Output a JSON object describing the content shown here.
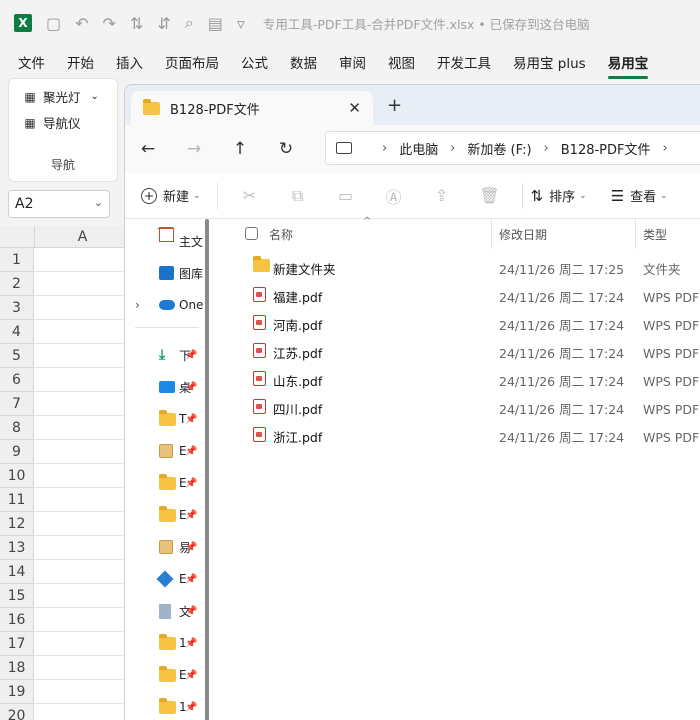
{
  "excel": {
    "filename": "专用工具-PDF工具-合并PDF文件.xlsx • 已保存到这台电脑",
    "tabs": [
      "文件",
      "开始",
      "插入",
      "页面布局",
      "公式",
      "数据",
      "审阅",
      "视图",
      "开发工具",
      "易用宝 plus",
      "易用宝"
    ],
    "active_tab_index": 10,
    "ribbon": {
      "spotlight": "聚光灯",
      "navigator": "导航仪",
      "group_label": "导航"
    },
    "name_box": "A2",
    "column": "A",
    "rows": [
      "1",
      "2",
      "3",
      "4",
      "5",
      "6",
      "7",
      "8",
      "9",
      "10",
      "11",
      "12",
      "13",
      "14",
      "15",
      "16",
      "17",
      "18",
      "19",
      "20"
    ]
  },
  "explorer": {
    "tab_title": "B128-PDF文件",
    "breadcrumb": [
      "此电脑",
      "新加卷 (F:)",
      "B128-PDF文件"
    ],
    "commands": {
      "new": "新建",
      "sort": "排序",
      "view": "查看"
    },
    "nav_pane": [
      {
        "label": "主文",
        "icon": "home-icon",
        "chevron": false
      },
      {
        "label": "图库",
        "icon": "gallery-icon",
        "chevron": false
      },
      {
        "label": "One",
        "icon": "onedrive-icon",
        "chevron": true
      },
      {
        "label": "下",
        "icon": "download-icon",
        "pinned": true
      },
      {
        "label": "桌",
        "icon": "desktop-icon",
        "pinned": true
      },
      {
        "label": "T",
        "icon": "folder-icon",
        "pinned": true
      },
      {
        "label": "E",
        "icon": "package-icon",
        "pinned": true
      },
      {
        "label": "E",
        "icon": "folder-icon",
        "pinned": true
      },
      {
        "label": "E",
        "icon": "folder-icon",
        "pinned": true
      },
      {
        "label": "易",
        "icon": "package-icon",
        "pinned": true
      },
      {
        "label": "E",
        "icon": "diamond-icon",
        "pinned": true
      },
      {
        "label": "文",
        "icon": "document-icon",
        "pinned": true
      },
      {
        "label": "1",
        "icon": "folder-icon",
        "pinned": true
      },
      {
        "label": "E",
        "icon": "folder-icon",
        "pinned": true
      },
      {
        "label": "1",
        "icon": "folder-icon",
        "pinned": true
      }
    ],
    "columns": {
      "name": "名称",
      "date": "修改日期",
      "type": "类型"
    },
    "files": [
      {
        "name": "新建文件夹",
        "date": "24/11/26 周二 17:25",
        "type": "文件夹",
        "icon": "folder-icon"
      },
      {
        "name": "福建.pdf",
        "date": "24/11/26 周二 17:24",
        "type": "WPS PDF 文",
        "icon": "pdf-icon"
      },
      {
        "name": "河南.pdf",
        "date": "24/11/26 周二 17:24",
        "type": "WPS PDF 文",
        "icon": "pdf-icon"
      },
      {
        "name": "江苏.pdf",
        "date": "24/11/26 周二 17:24",
        "type": "WPS PDF 文",
        "icon": "pdf-icon"
      },
      {
        "name": "山东.pdf",
        "date": "24/11/26 周二 17:24",
        "type": "WPS PDF 文",
        "icon": "pdf-icon"
      },
      {
        "name": "四川.pdf",
        "date": "24/11/26 周二 17:24",
        "type": "WPS PDF 文",
        "icon": "pdf-icon"
      },
      {
        "name": "浙江.pdf",
        "date": "24/11/26 周二 17:24",
        "type": "WPS PDF 文",
        "icon": "pdf-icon"
      }
    ]
  }
}
